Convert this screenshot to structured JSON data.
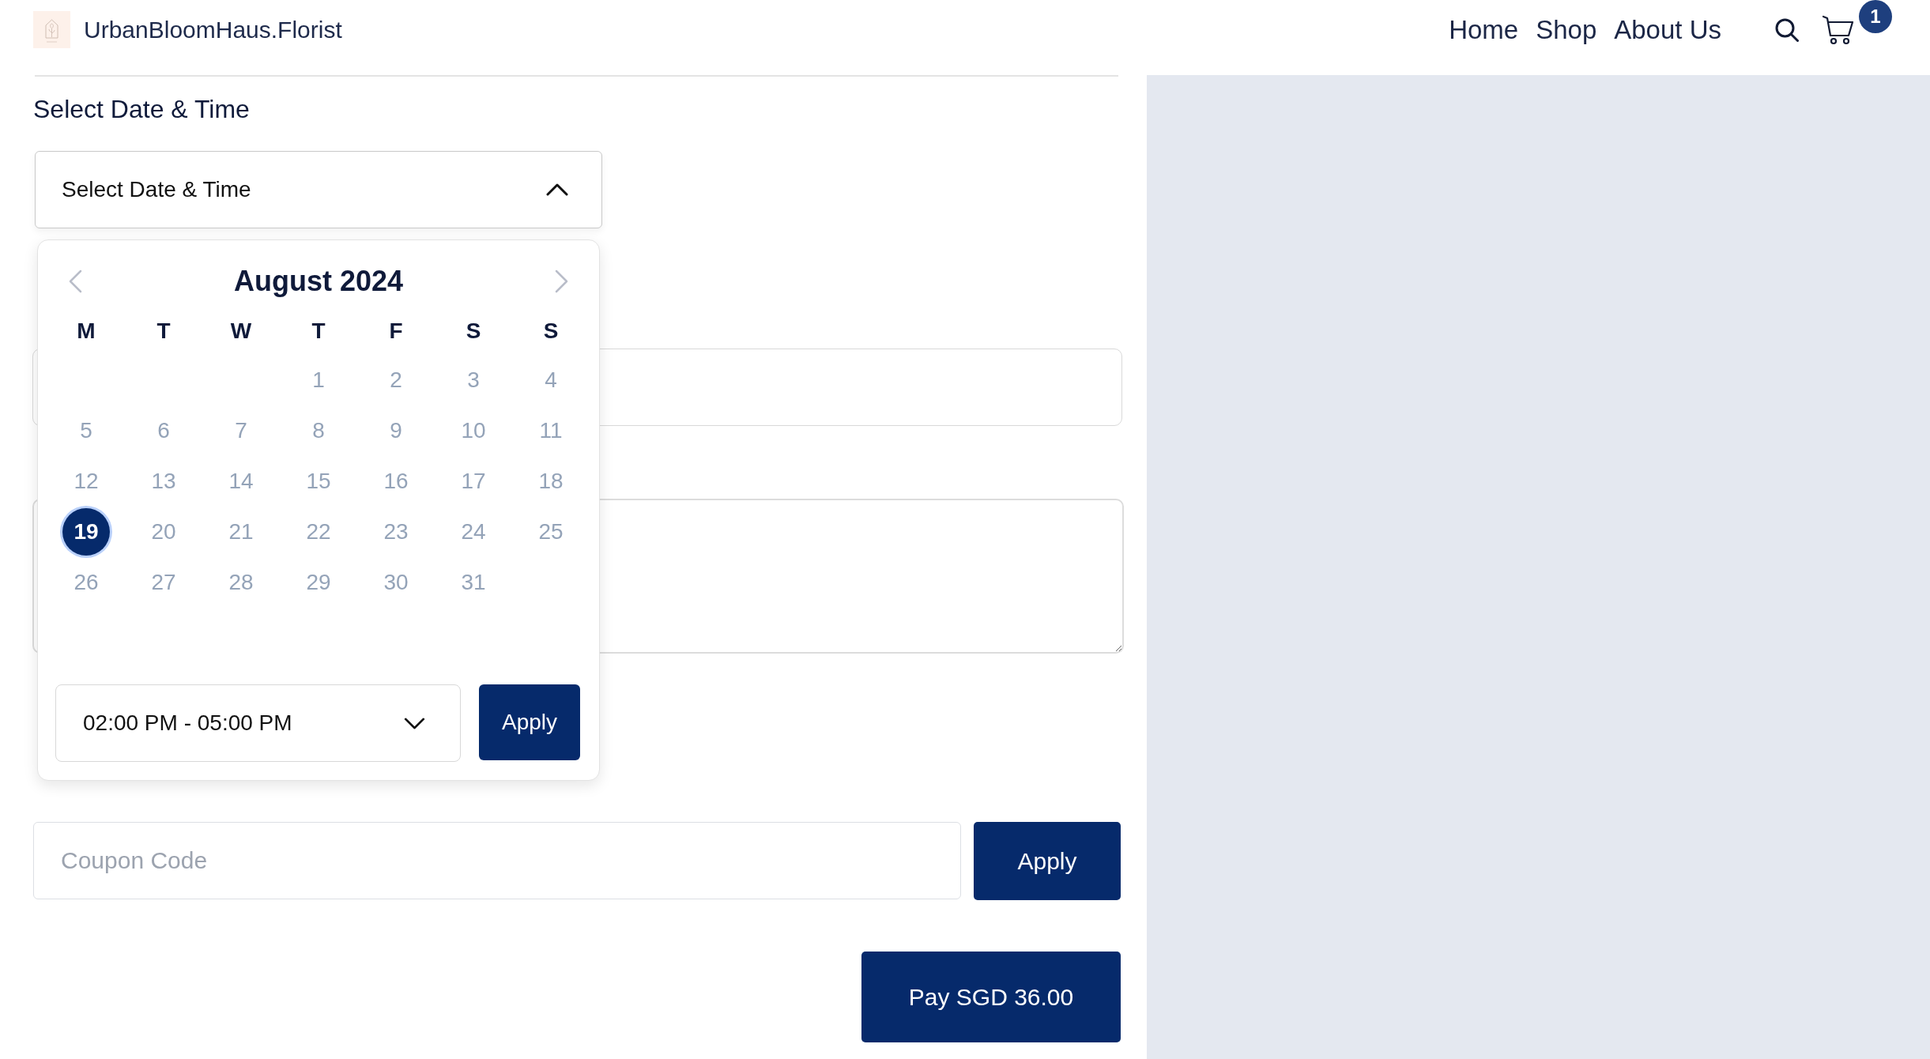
{
  "header": {
    "brand": "UrbanBloomHaus.Florist",
    "nav": [
      {
        "label": "Home"
      },
      {
        "label": "Shop"
      },
      {
        "label": "About Us"
      }
    ],
    "cart_count": "1"
  },
  "delivery": {
    "label": "Select Date & Time",
    "dropdown": {
      "value": "Select Date & Time",
      "expanded": true
    }
  },
  "calendar": {
    "month": "August 2024",
    "weekdays": [
      "M",
      "T",
      "W",
      "T",
      "F",
      "S",
      "S"
    ],
    "weeks": [
      {
        "kind": "leading",
        "days": [
          {
            "label": "1",
            "selected": false
          },
          {
            "label": "2",
            "selected": false
          },
          {
            "label": "3",
            "selected": false
          },
          {
            "label": "4",
            "selected": false
          }
        ]
      },
      {
        "kind": "full",
        "days": [
          {
            "label": "5",
            "selected": false
          },
          {
            "label": "6",
            "selected": false
          },
          {
            "label": "7",
            "selected": false
          },
          {
            "label": "8",
            "selected": false
          },
          {
            "label": "9",
            "selected": false
          },
          {
            "label": "10",
            "selected": false
          },
          {
            "label": "11",
            "selected": false
          }
        ]
      },
      {
        "kind": "full",
        "days": [
          {
            "label": "12",
            "selected": false
          },
          {
            "label": "13",
            "selected": false
          },
          {
            "label": "14",
            "selected": false
          },
          {
            "label": "15",
            "selected": false
          },
          {
            "label": "16",
            "selected": false
          },
          {
            "label": "17",
            "selected": false
          },
          {
            "label": "18",
            "selected": false
          }
        ]
      },
      {
        "kind": "full",
        "days": [
          {
            "label": "19",
            "selected": true
          },
          {
            "label": "20",
            "selected": false
          },
          {
            "label": "21",
            "selected": false
          },
          {
            "label": "22",
            "selected": false
          },
          {
            "label": "23",
            "selected": false
          },
          {
            "label": "24",
            "selected": false
          },
          {
            "label": "25",
            "selected": false
          }
        ]
      },
      {
        "kind": "trailing",
        "days": [
          {
            "label": "26",
            "selected": false
          },
          {
            "label": "27",
            "selected": false
          },
          {
            "label": "28",
            "selected": false
          },
          {
            "label": "29",
            "selected": false
          },
          {
            "label": "30",
            "selected": false
          },
          {
            "label": "31",
            "selected": false
          }
        ]
      }
    ],
    "time_slot": {
      "value": "02:00 PM - 05:00 PM"
    },
    "apply_button": "Apply"
  },
  "fields": [
    {
      "kind": "text"
    },
    {
      "kind": "textarea"
    }
  ],
  "coupon": {
    "placeholder": "Coupon Code",
    "button": "Apply"
  },
  "pay_button": "Pay SGD 36.00"
}
